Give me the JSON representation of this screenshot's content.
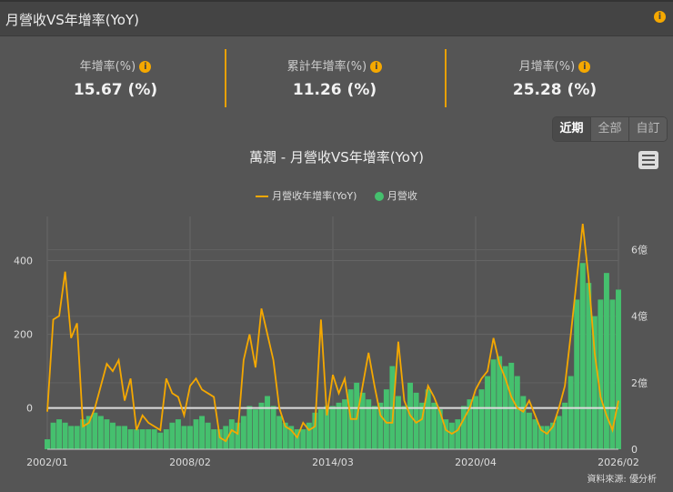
{
  "header": {
    "title": "月營收VS年增率(YoY)",
    "info_icon": "i"
  },
  "stats": [
    {
      "label": "年增率(%)",
      "value": "15.67 (%)"
    },
    {
      "label": "累計年增率(%)",
      "value": "11.26 (%)"
    },
    {
      "label": "月增率(%)",
      "value": "25.28 (%)"
    }
  ],
  "range_buttons": [
    {
      "label": "近期",
      "active": true
    },
    {
      "label": "全部",
      "active": false
    },
    {
      "label": "自訂",
      "active": false
    }
  ],
  "source": "資料來源: 優分析",
  "colors": {
    "line": "#f5a800",
    "bar": "#45c06e",
    "background": "#555555"
  },
  "chart_data": {
    "type": "bar+line",
    "title": "萬潤 - 月營收VS年增率(YoY)",
    "legend": [
      "月營收年增率(YoY)",
      "月營收"
    ],
    "legend_position": "top",
    "x_ticks": [
      "2002/01",
      "2008/02",
      "2014/03",
      "2020/04",
      "2026/02"
    ],
    "y_left_ticks": [
      "0",
      "200",
      "400"
    ],
    "y_left_range": [
      -112,
      520
    ],
    "y_right_ticks": [
      "0",
      "2億",
      "4億",
      "6億"
    ],
    "y_right_range": [
      0,
      7
    ],
    "x_start": "2002Q1",
    "x_step": "quarter",
    "series": [
      {
        "name": "月營收年增率(YoY)",
        "axis": "left",
        "unit": "%",
        "values": [
          -10,
          240,
          250,
          370,
          190,
          230,
          -50,
          -40,
          0,
          60,
          120,
          100,
          130,
          20,
          80,
          -60,
          -20,
          -40,
          -50,
          -60,
          80,
          40,
          30,
          -20,
          60,
          80,
          50,
          40,
          30,
          -80,
          -90,
          -60,
          -70,
          130,
          200,
          110,
          270,
          200,
          130,
          0,
          -50,
          -60,
          -80,
          -40,
          -60,
          -50,
          240,
          -20,
          90,
          40,
          80,
          -30,
          -30,
          60,
          150,
          60,
          -20,
          -40,
          -40,
          180,
          20,
          -20,
          -40,
          -30,
          60,
          30,
          -10,
          -60,
          -70,
          -60,
          -30,
          0,
          50,
          80,
          100,
          190,
          120,
          80,
          30,
          0,
          -10,
          20,
          -20,
          -60,
          -70,
          -50,
          0,
          60,
          200,
          350,
          500,
          350,
          150,
          30,
          -20,
          -60,
          20
        ]
      },
      {
        "name": "月營收",
        "axis": "right",
        "unit": "億",
        "values": [
          0.3,
          0.8,
          0.9,
          0.8,
          0.7,
          0.7,
          0.9,
          1.0,
          1.1,
          1.0,
          0.9,
          0.8,
          0.7,
          0.7,
          0.6,
          0.6,
          0.6,
          0.6,
          0.6,
          0.5,
          0.6,
          0.8,
          0.9,
          0.7,
          0.7,
          0.9,
          1.0,
          0.8,
          0.6,
          0.6,
          0.7,
          0.9,
          0.8,
          1.0,
          1.3,
          1.2,
          1.4,
          1.6,
          1.3,
          1.0,
          0.8,
          0.7,
          0.6,
          0.6,
          0.8,
          1.1,
          1.2,
          1.3,
          1.3,
          1.4,
          1.5,
          1.8,
          2.0,
          1.7,
          1.5,
          1.3,
          1.4,
          1.8,
          2.5,
          1.6,
          1.3,
          2.0,
          1.7,
          1.4,
          1.8,
          1.4,
          1.2,
          0.9,
          0.8,
          0.9,
          1.3,
          1.5,
          1.6,
          1.8,
          2.2,
          2.7,
          2.8,
          2.5,
          2.6,
          2.2,
          1.6,
          1.1,
          0.9,
          0.7,
          0.7,
          0.8,
          1.0,
          1.4,
          2.2,
          4.5,
          5.6,
          5.0,
          4.0,
          4.5,
          5.3,
          4.5,
          4.8
        ]
      }
    ]
  }
}
